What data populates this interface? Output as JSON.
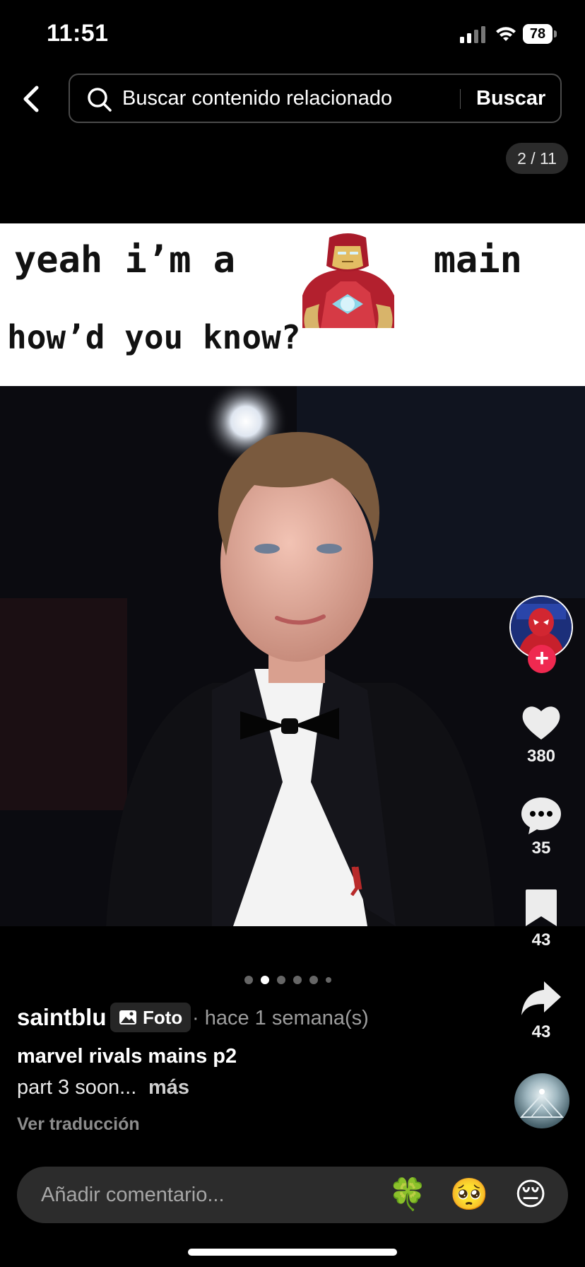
{
  "status_bar": {
    "time": "11:51",
    "battery": "78"
  },
  "search": {
    "placeholder": "Buscar contenido relacionado",
    "button": "Buscar"
  },
  "post": {
    "counter": "2 / 11",
    "meme_text": {
      "line1_before": "yeah i’m a",
      "line1_after": "main",
      "line2": "how’d you know?"
    },
    "carousel": {
      "total_dots": 6,
      "active_index": 1
    }
  },
  "rail": {
    "likes": "380",
    "comments": "35",
    "saves": "43",
    "shares": "43"
  },
  "caption": {
    "username": "saintblu",
    "tag": "Foto",
    "time": "· hace 1 semana(s)",
    "title": "marvel rivals mains p2",
    "description": "part 3 soon...",
    "more": "más",
    "translate": "Ver traducción"
  },
  "comment_bar": {
    "placeholder": "Añadir comentario...",
    "emojis": [
      "🍀",
      "🥺",
      "😔"
    ]
  },
  "colors": {
    "accent": "#ef2950",
    "background": "#000000"
  }
}
